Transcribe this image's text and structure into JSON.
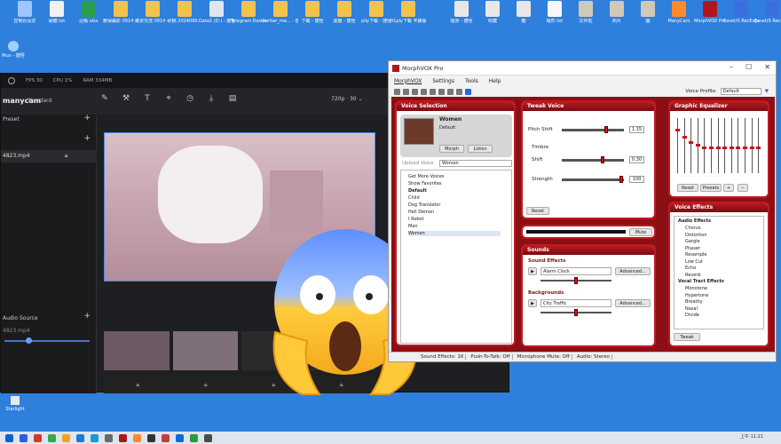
{
  "desktop": {
    "icons_top": [
      {
        "label": "控制台设定",
        "color": "#9ec5ff"
      },
      {
        "label": "硬體.txt",
        "color": "#f1f1f1"
      },
      {
        "label": "記帳.xlsx",
        "color": "#29a04d"
      },
      {
        "label": "教保攝影 0914 - 捷徑",
        "color": "#f2c14e"
      },
      {
        "label": "東京交流 0914 - 捷徑",
        "color": "#f2c14e"
      },
      {
        "label": "砂鍋 2024090...",
        "color": "#f2c14e"
      },
      {
        "label": "Data1 (D:) - 捷徑",
        "color": "#dfe6ef"
      },
      {
        "label": "Telegram Desktop",
        "color": "#f2c14e"
      },
      {
        "label": "twitter_me... - 捷徑",
        "color": "#f2c14e"
      },
      {
        "label": "下載 - 捷徑",
        "color": "#f2c14e"
      },
      {
        "label": "書籤 - 捷徑",
        "color": "#f2c14e"
      },
      {
        "label": "pliy下載 - 捷徑",
        "color": "#f2c14e"
      },
      {
        "label": "01ply下載 丰錄版) -",
        "color": "#f2c14e"
      },
      {
        "label": "隨身 - 捷徑",
        "color": "#e8e8e8"
      },
      {
        "label": "收藏",
        "color": "#e8e8e8"
      },
      {
        "label": "鑑",
        "color": "#e8e8e8"
      },
      {
        "label": "帳形.txt",
        "color": "#f7f7f7"
      },
      {
        "label": "文件框",
        "color": "#d0c9b8"
      },
      {
        "label": "照片",
        "color": "#d0c9b8"
      },
      {
        "label": "圖",
        "color": "#d0c9b8"
      },
      {
        "label": "ManyCam",
        "color": "#ff8a2b"
      },
      {
        "label": "MorphVOX Pro",
        "color": "#b0161d"
      },
      {
        "label": "EaseUS RecExperts",
        "color": "#3b6fe0"
      },
      {
        "label": "EaseUS RecExperts",
        "color": "#3b6fe0"
      }
    ],
    "left_icon_label": "Mux - 捷徑",
    "bottom_left_label": "Starlight"
  },
  "manycam": {
    "stat_fps": "FPS 30",
    "stat_cpu": "CPU 1%",
    "stat_ram": "RAM 334MB",
    "brand": "manycam",
    "edition": "Standard",
    "resolution": "720p · 30 ⌄",
    "panel_title": "Preset",
    "file_name": "4823.mp4",
    "audio_title": "Audio Source",
    "audio_file": "4823.mp4",
    "tool_icons": [
      "pen-icon",
      "wand-icon",
      "text-icon",
      "cursor-icon",
      "clock-icon",
      "download-icon",
      "film-icon"
    ]
  },
  "morphvox": {
    "title": "MorphVOX Pro",
    "menu": [
      "MorphVOX",
      "Settings",
      "Tools",
      "Help"
    ],
    "voice_profile_label": "Voice Profile:",
    "voice_profile_value": "Default",
    "voice_selection": {
      "header": "Voice Selection",
      "voice_name": "Women",
      "voice_sub": "Default",
      "morph_btn": "Morph",
      "listen_btn": "Listen",
      "combo_label": "Upload Voice",
      "combo_value": "Women",
      "list": [
        {
          "text": "Get More Voices",
          "bold": false
        },
        {
          "text": "Show Favorites",
          "bold": false
        },
        {
          "text": "Default",
          "bold": true
        },
        {
          "text": "Child",
          "bold": false
        },
        {
          "text": "Dog Translator",
          "bold": false
        },
        {
          "text": "Hell Demon",
          "bold": false
        },
        {
          "text": "I Robot",
          "bold": false
        },
        {
          "text": "Man",
          "bold": false
        },
        {
          "text": "Women",
          "bold": false
        }
      ]
    },
    "tweak_voice": {
      "header": "Tweak Voice",
      "pitch_label": "Pitch Shift",
      "pitch_value": "1.15",
      "pitch_level": 0.72,
      "timbre_label": "Timbre",
      "shift_label": "Shift",
      "shift_value": "0.30",
      "shift_level": 0.65,
      "strength_label": "Strength",
      "strength_value": "100",
      "strength_level": 0.95,
      "reset_btn": "Reset",
      "mute_btn": "Mute"
    },
    "sounds": {
      "header": "Sounds",
      "effects_label": "Sound Effects",
      "effects_value": "Alarm Clock",
      "effects_adv": "Advanced...",
      "backgrounds_label": "Backgrounds",
      "backgrounds_value": "City Traffic",
      "backgrounds_adv": "Advanced..."
    },
    "eq": {
      "header": "Graphic Equalizer",
      "reset_btn": "Reset",
      "presets_btn": "Presets",
      "levels": [
        0.2,
        0.35,
        0.45,
        0.5,
        0.55,
        0.55,
        0.55,
        0.55,
        0.55,
        0.55,
        0.55,
        0.55,
        0.55
      ]
    },
    "voice_effects": {
      "header": "Voice Effects",
      "groups": [
        {
          "title": "Audio Effects",
          "items": [
            "Chorus",
            "Distortion",
            "Gargle",
            "Phaser",
            "Resample",
            "Low Cut",
            "Echo",
            "Reverb"
          ]
        },
        {
          "title": "Vocal Tract Effects",
          "items": [
            "Monotone",
            "Hypertone",
            "Breathy",
            "Nasal",
            "Divide"
          ]
        }
      ],
      "tweak_btn": "Tweak"
    },
    "status": [
      "Sound Effects: 16",
      "Push-To-Talk: Off",
      "Microphone Mute: Off",
      "Audio: Stereo"
    ]
  },
  "taskbar": {
    "clock": "上午 11:21",
    "colors": [
      "#0a61cc",
      "#2b5fd9",
      "#d4372c",
      "#39a747",
      "#f3a41b",
      "#1c7bd6",
      "#1998d8",
      "#6a6a6a",
      "#b0161d",
      "#ff8a2b",
      "#333333",
      "#c13e3e",
      "#0b6bd1",
      "#2a9a43",
      "#4c4c4c"
    ]
  }
}
